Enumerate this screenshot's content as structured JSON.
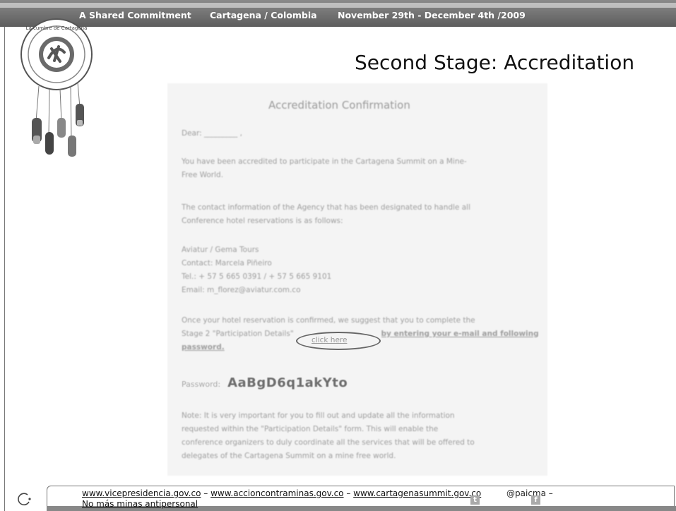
{
  "header": {
    "item1": "A Shared Commitment",
    "item2": "Cartagena / Colombia",
    "item3": "November 29th  - December 4th  /2009"
  },
  "slide": {
    "title": "Second Stage: Accreditation"
  },
  "logo": {
    "ring_text": "La cumbre de Cartagena por un mundo sin minas antipersonal",
    "icon_name": "cartagena-summit-logo"
  },
  "document": {
    "title": "Accreditation Confirmation",
    "greeting": "Dear: _________ ,",
    "para1": [
      "You have been accredited to participate in the Cartagena Summit on a Mine-",
      "Free World."
    ],
    "para2": [
      "The contact information of the Agency that has been designated to handle all",
      "Conference hotel reservations is as follows:"
    ],
    "contact": [
      "Aviatur / Gema Tours",
      "Contact: Marcela Piñeiro",
      "Tel.: + 57 5 665 0391 / + 57 5 665 9101",
      "Email: m_florez@aviatur.com.co"
    ],
    "para3": [
      "Once your hotel reservation is confirmed, we suggest that you to complete the",
      "Stage 2 \"Participation Details\"",
      "password."
    ],
    "para3_link": "click here",
    "para3_tail": "by entering your e-mail and following",
    "password_label": "Password:",
    "password_value": "AaBgD6q1akYto",
    "note": [
      "Note: It is very important for you to fill out and update all the information",
      "requested within the \"Participation Details\" form. This will enable the",
      "conference organizers to duly coordinate all the services that will be offered to",
      "delegates of the Cartagena Summit on a mine free world."
    ]
  },
  "footer": {
    "link1": "www.vicepresidencia.gov.co",
    "sep1": " – ",
    "link2": "www.accioncontraminas.gov.co",
    "sep2": " – ",
    "link3": "www.cartagenasummit.gov.co",
    "handle": "@paicma  –",
    "line2": "No más minas antipersonal"
  }
}
